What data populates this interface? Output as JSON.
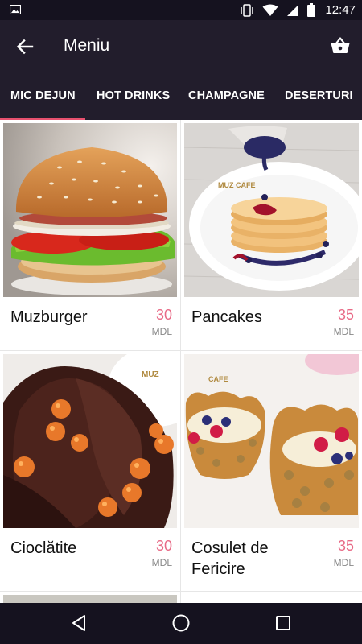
{
  "status_bar": {
    "time": "12:47",
    "icons": [
      "image-icon",
      "vibrate-icon",
      "wifi-icon",
      "signal-icon",
      "battery-icon"
    ]
  },
  "app_bar": {
    "title": "Meniu",
    "back_icon": "arrow-left-icon",
    "cart_icon": "basket-icon"
  },
  "tabs": [
    {
      "label": "MIC DEJUN",
      "selected": true
    },
    {
      "label": "HOT DRINKS",
      "selected": false
    },
    {
      "label": "CHAMPAGNE",
      "selected": false
    },
    {
      "label": "DESERTURI",
      "selected": false
    }
  ],
  "colors": {
    "accent": "#e8516f",
    "price": "#e86a86",
    "toolbar": "#221d2c"
  },
  "products": [
    {
      "name": "Muzburger",
      "price": "30",
      "currency": "MDL"
    },
    {
      "name": "Pancakes",
      "price": "35",
      "currency": "MDL"
    },
    {
      "name": "Cioclătite",
      "price": "30",
      "currency": "MDL"
    },
    {
      "name": "Cosulet de Fericire",
      "price": "35",
      "currency": "MDL"
    }
  ],
  "photo_labels": {
    "pancakes_plate": "MUZ CAFE",
    "crepes_plate": "MUZ",
    "basket_plate": "CAFE"
  },
  "nav_bar": {
    "icons": [
      "back-triangle-icon",
      "home-circle-icon",
      "recents-square-icon"
    ]
  }
}
